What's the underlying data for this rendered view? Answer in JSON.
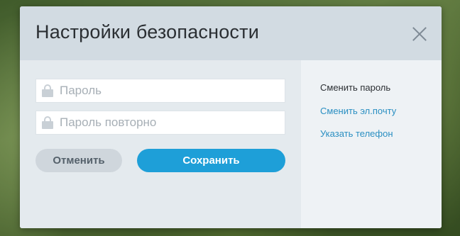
{
  "dialog": {
    "title": "Настройки безопасности",
    "close_icon": "close-icon"
  },
  "form": {
    "password": {
      "value": "",
      "placeholder": "Пароль",
      "icon": "lock-icon"
    },
    "password_repeat": {
      "value": "",
      "placeholder": "Пароль повторно",
      "icon": "lock-icon"
    },
    "cancel_label": "Отменить",
    "save_label": "Сохранить"
  },
  "sidebar": {
    "items": [
      {
        "label": "Сменить пароль",
        "active": true
      },
      {
        "label": "Сменить эл.почту",
        "active": false
      },
      {
        "label": "Указать телефон",
        "active": false
      }
    ]
  },
  "colors": {
    "accent": "#1e9fd8",
    "link": "#2a8fc2",
    "header_bg": "#d2dbe2",
    "body_bg": "#e4eaee"
  }
}
